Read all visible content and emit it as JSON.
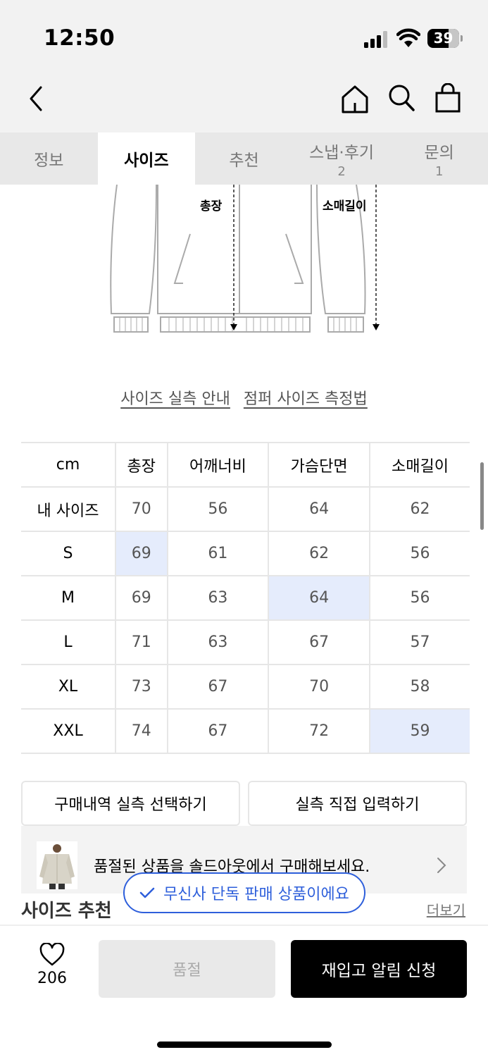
{
  "status_bar": {
    "time": "12:50",
    "battery": "39"
  },
  "tabs": [
    {
      "label": "정보",
      "count": ""
    },
    {
      "label": "사이즈",
      "count": ""
    },
    {
      "label": "추천",
      "count": ""
    },
    {
      "label": "스냅·후기",
      "count": "2"
    },
    {
      "label": "문의",
      "count": "1"
    }
  ],
  "diagram": {
    "label_length": "총장",
    "label_sleeve": "소매길이"
  },
  "links": {
    "size_guide": "사이즈 실측 안내",
    "measure_guide": "점퍼 사이즈 측정법"
  },
  "size_table": {
    "headers": [
      "cm",
      "총장",
      "어깨너비",
      "가슴단면",
      "소매길이"
    ],
    "rows": [
      [
        "내 사이즈",
        "70",
        "56",
        "64",
        "62"
      ],
      [
        "S",
        "69",
        "61",
        "62",
        "56"
      ],
      [
        "M",
        "69",
        "63",
        "64",
        "56"
      ],
      [
        "L",
        "71",
        "63",
        "67",
        "57"
      ],
      [
        "XL",
        "73",
        "67",
        "70",
        "58"
      ],
      [
        "XXL",
        "74",
        "67",
        "72",
        "59"
      ]
    ]
  },
  "actions": {
    "select_purchase": "구매내역 실측 선택하기",
    "manual_input": "실측 직접 입력하기"
  },
  "banner": {
    "text": "품절된 상품을 솔드아웃에서 구매해보세요."
  },
  "pill": {
    "text": "무신사 단독 판매 상품이에요"
  },
  "under": {
    "title": "사이즈 추천",
    "more": "더보기"
  },
  "bottom": {
    "like_count": "206",
    "soldout_label": "품절",
    "notify_label": "재입고 알림 신청"
  },
  "colors": {
    "accent": "#2e5fdb",
    "highlight": "#e5ecfc"
  }
}
